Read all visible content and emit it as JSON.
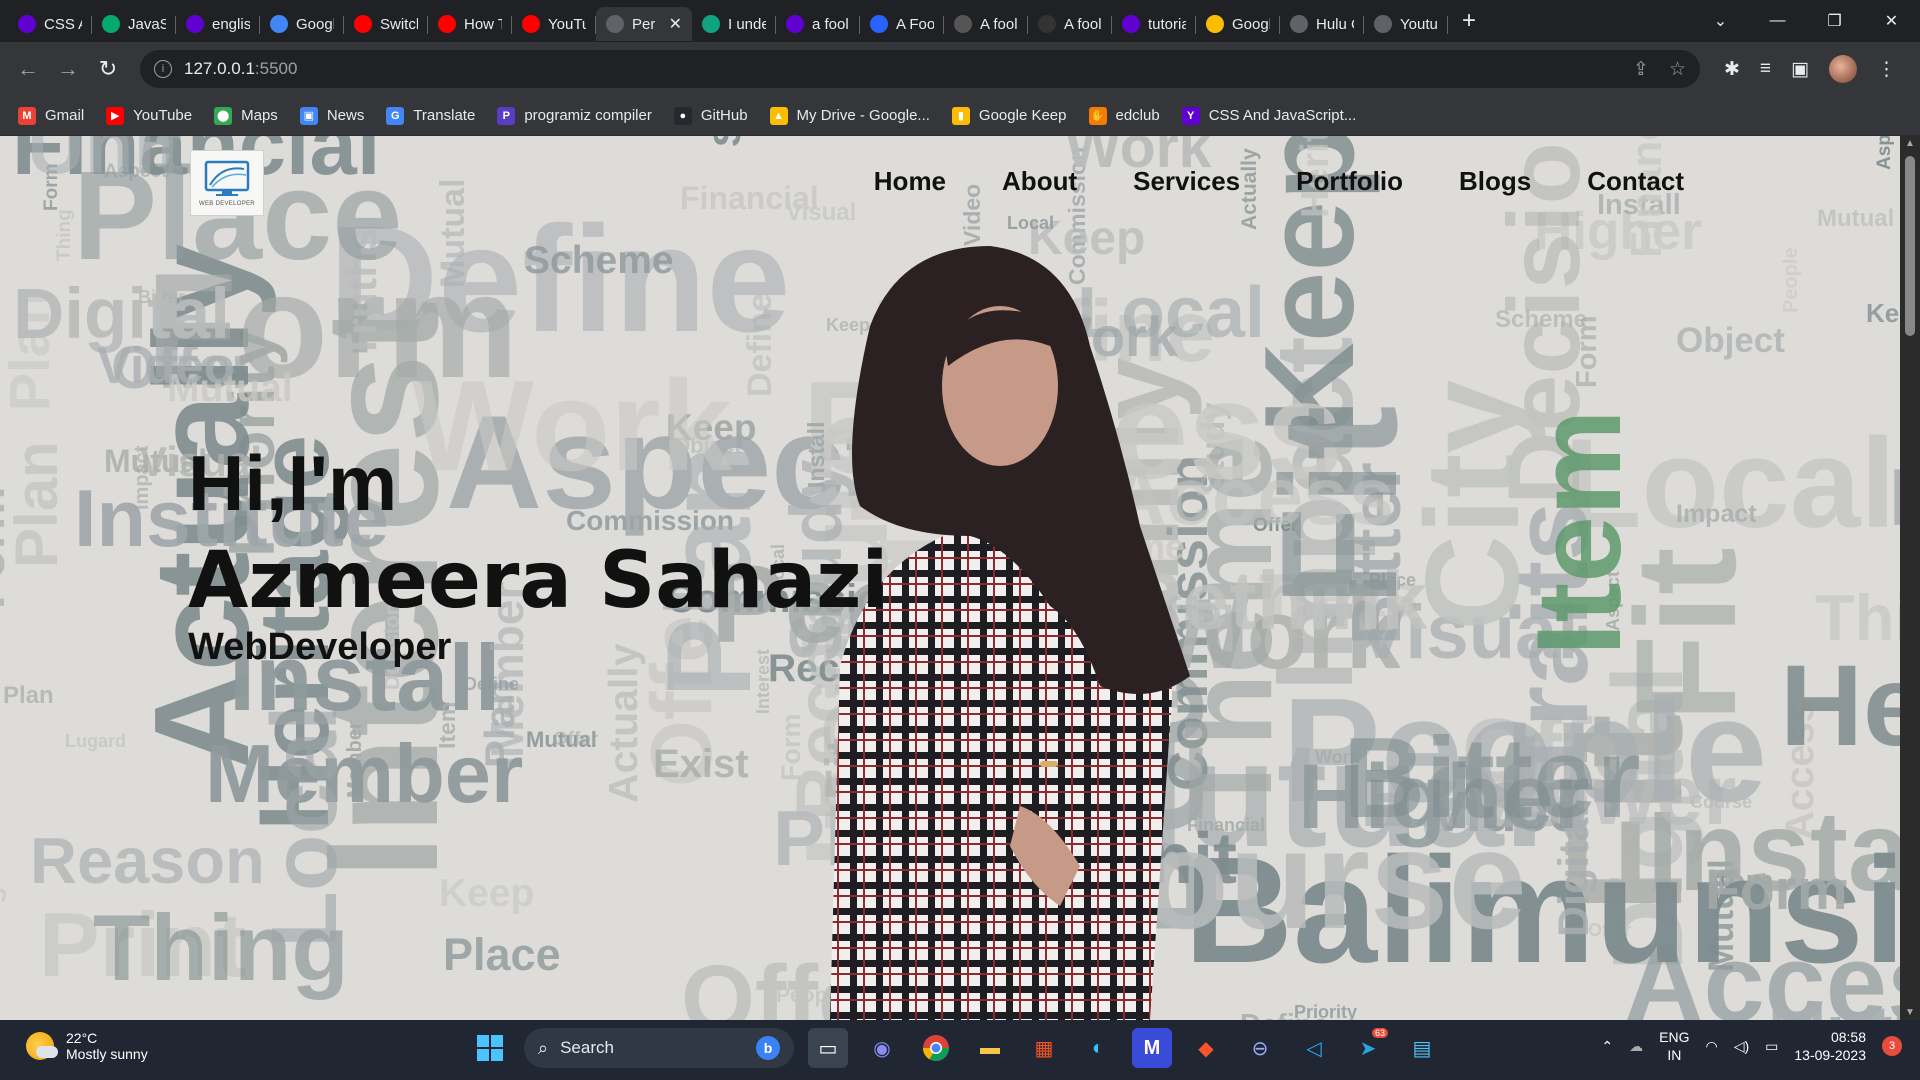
{
  "tabs": [
    {
      "label": "CSS Ar",
      "icon": "yahoo-icon",
      "color": "#6001d2"
    },
    {
      "label": "JavaSc",
      "icon": "w3schools-icon",
      "color": "#04aa6d"
    },
    {
      "label": "englis",
      "icon": "yahoo-icon",
      "color": "#6001d2"
    },
    {
      "label": "Googl",
      "icon": "google-translate-icon",
      "color": "#4285f4"
    },
    {
      "label": "Switch",
      "icon": "youtube-icon",
      "color": "#ff0000"
    },
    {
      "label": "How T",
      "icon": "youtube-icon",
      "color": "#ff0000"
    },
    {
      "label": "YouTu",
      "icon": "youtube-icon",
      "color": "#ff0000"
    },
    {
      "label": "Per",
      "icon": "globe-icon",
      "color": "#5f6368",
      "active": true
    },
    {
      "label": "I unde",
      "icon": "chatgpt-icon",
      "color": "#10a37f"
    },
    {
      "label": "a fool",
      "icon": "yahoo-icon",
      "color": "#6001d2"
    },
    {
      "label": "A Fool",
      "icon": "p-icon",
      "color": "#2962ff"
    },
    {
      "label": "A fool",
      "icon": "wordweb-icon",
      "color": "#555555"
    },
    {
      "label": "A fool",
      "icon": "g-icon",
      "color": "#333333"
    },
    {
      "label": "tutoria",
      "icon": "yahoo-icon",
      "color": "#6001d2"
    },
    {
      "label": "Googl",
      "icon": "google-keep-icon",
      "color": "#fbbc04"
    },
    {
      "label": "Hulu C",
      "icon": "globe-icon",
      "color": "#5f6368"
    },
    {
      "label": "Youtul",
      "icon": "globe-icon",
      "color": "#5f6368"
    }
  ],
  "browser": {
    "url_host": "127.0.0.1",
    "url_port": ":5500"
  },
  "bookmarks": [
    {
      "label": "Gmail",
      "icon": "gmail-icon",
      "color": "#ea4335",
      "glyph": "M"
    },
    {
      "label": "YouTube",
      "icon": "youtube-icon",
      "color": "#ff0000",
      "glyph": "▶"
    },
    {
      "label": "Maps",
      "icon": "maps-icon",
      "color": "#34a853",
      "glyph": "⬤"
    },
    {
      "label": "News",
      "icon": "news-icon",
      "color": "#4285f4",
      "glyph": "▣"
    },
    {
      "label": "Translate",
      "icon": "translate-icon",
      "color": "#4285f4",
      "glyph": "G"
    },
    {
      "label": "programiz compiler",
      "icon": "programiz-icon",
      "color": "#5b3cc4",
      "glyph": "P"
    },
    {
      "label": "GitHub",
      "icon": "github-icon",
      "color": "#24292e",
      "glyph": "●"
    },
    {
      "label": "My Drive - Google...",
      "icon": "drive-icon",
      "color": "#fbbc04",
      "glyph": "▲"
    },
    {
      "label": "Google Keep",
      "icon": "keep-icon",
      "color": "#fbbc04",
      "glyph": "▮"
    },
    {
      "label": "edclub",
      "icon": "edclub-icon",
      "color": "#f57c00",
      "glyph": "✋"
    },
    {
      "label": "CSS And JavaScript...",
      "icon": "yahoo-icon",
      "color": "#6001d2",
      "glyph": "Y"
    }
  ],
  "site": {
    "logo_text": "WEB DEVELOPER",
    "nav": [
      "Home",
      "About",
      "Services",
      "Portfolio",
      "Blogs",
      "Contact"
    ],
    "greeting": "Hi,I'm",
    "name": "Azmeera Sahazi",
    "role": "WebDeveloper"
  },
  "taskbar": {
    "temperature": "22°C",
    "weather": "Mostly sunny",
    "search_placeholder": "Search",
    "lang_top": "ENG",
    "lang_bottom": "IN",
    "time": "08:58",
    "date": "13-09-2023",
    "notification_count": "3",
    "telegram_badge": "63"
  }
}
